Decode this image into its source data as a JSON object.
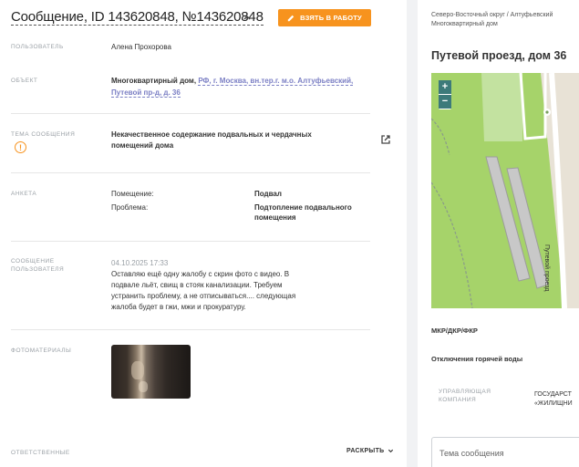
{
  "header": {
    "title": "Сообщение, ID 143620848, №143620848",
    "work_button": "ВЗЯТЬ В РАБОТУ"
  },
  "fields": {
    "user_label": "ПОЛЬЗОВАТЕЛЬ",
    "user_value": "Алена Прохорова",
    "object_label": "ОБЪЕКТ",
    "object_prefix": "Многоквартирный дом,",
    "object_link_line1": "РФ, г. Москва, вн.тер.г. м.о. Алтуфьевский,",
    "object_link_line2": "Путевой пр-д, д. 36",
    "topic_label": "ТЕМА СООБЩЕНИЯ",
    "topic_line1": "Некачественное содержание подвальных и чердачных",
    "topic_line2": "помещений дома",
    "questionnaire_label": "АНКЕТА",
    "q_rows": [
      {
        "key": "Помещение:",
        "value_line1": "Подвал",
        "value_line2": ""
      },
      {
        "key": "Проблема:",
        "value_line1": "Подтопление подвального",
        "value_line2": "помещения"
      }
    ],
    "message_label_line1": "СООБЩЕНИЕ",
    "message_label_line2": "ПОЛЬЗОВАТЕЛЯ",
    "message_date": "04.10.2025 17:33",
    "message_lines": [
      "Оставляю ещё одну жалобу с скрин фото с видео. В",
      "подвале льёт, свищ в стояк канализации. Требуем",
      "устранить проблему, а не отписываться.... следующая",
      "жалоба будет в гжи, мжи и прокуратуру."
    ],
    "photos_label": "ФОТОМАТЕРИАЛЫ",
    "responsible_label": "ОТВЕТСТВЕННЫЕ",
    "expand_label": "РАСКРЫТЬ"
  },
  "right": {
    "breadcrumb_line1": "Северо-Восточный округ / Алтуфьевский",
    "breadcrumb_line2": "Многоквартирный дом",
    "address": "Путевой проезд, дом 36",
    "zoom_in": "+",
    "zoom_out": "−",
    "street_label": "Путевой проезд",
    "mkr_label": "МКР/ДКР/ФКР",
    "hot_water_label": "Отключения горячей воды",
    "company_label_line1": "УПРАВЛЯЮЩАЯ",
    "company_label_line2": "КОМПАНИЯ",
    "company_value_line1": "ГОСУДАРСТ",
    "company_value_line2": "«ЖИЛИЩНИ",
    "topic_input_placeholder": "Тема сообщения"
  },
  "colors": {
    "accent": "#f7931e",
    "link": "#7b7fc4",
    "map_green": "#a6d36a",
    "map_zoom": "#3d7a7a"
  },
  "icons": [
    "pencil-icon",
    "chevron-up-icon",
    "warning-icon",
    "external-link-icon",
    "chevron-down-icon",
    "map-marker-icon"
  ]
}
